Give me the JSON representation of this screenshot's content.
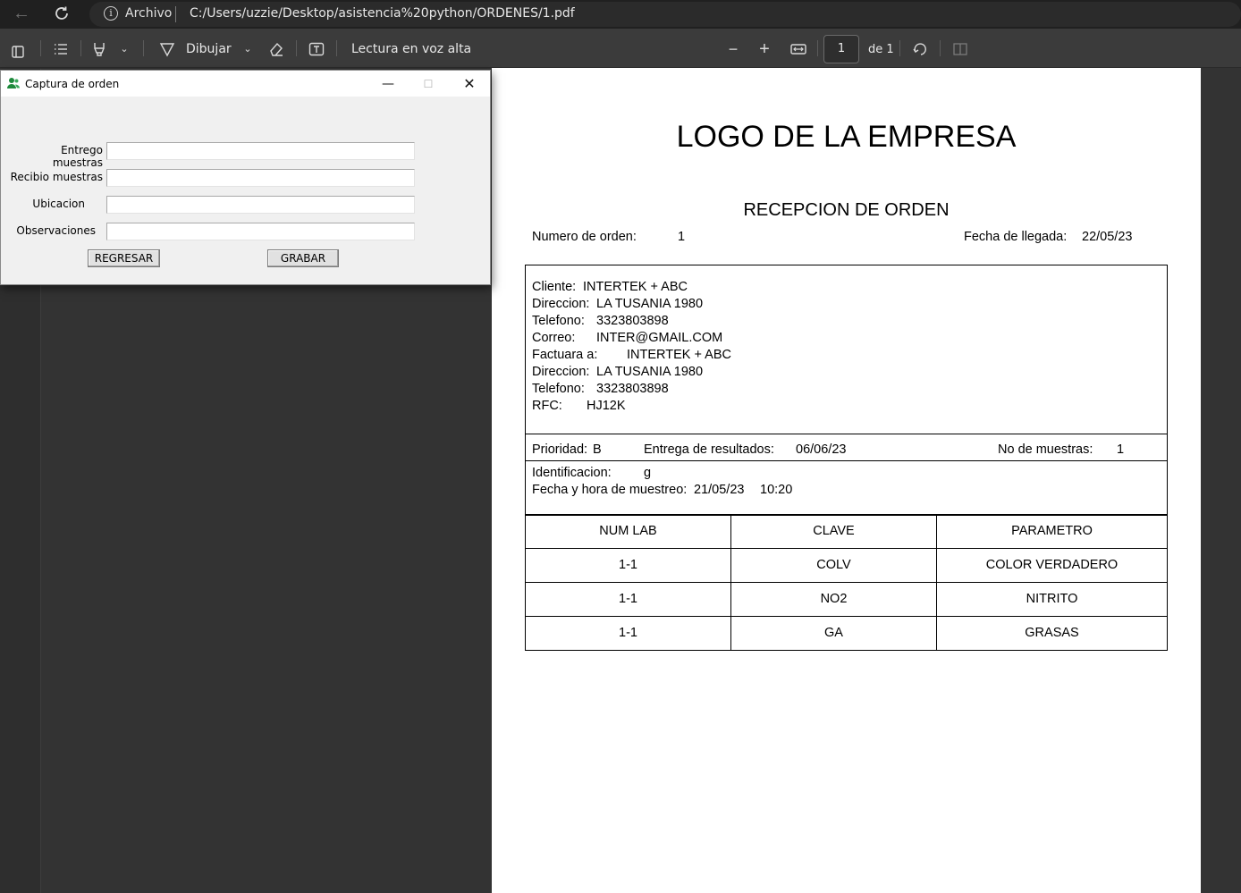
{
  "browser": {
    "file_label": "Archivo",
    "url": "C:/Users/uzzie/Desktop/asistencia%20python/ORDENES/1.pdf"
  },
  "toolbar": {
    "draw_label": "Dibujar",
    "read_aloud_label": "Lectura en voz alta",
    "page_current": "1",
    "page_total_label": "de 1",
    "icons": [
      "sidebar-icon",
      "contents-icon",
      "highlight-icon",
      "chevron-down-icon",
      "draw-icon",
      "eraser-icon",
      "text-box-icon",
      "zoom-out-icon",
      "zoom-in-icon",
      "fit-page-icon",
      "rotate-icon",
      "two-page-icon"
    ]
  },
  "dialog": {
    "title": "Captura de orden",
    "fields": [
      {
        "label": "Entrego muestras",
        "value": ""
      },
      {
        "label": "Recibio muestras",
        "value": ""
      },
      {
        "label": "Ubicacion",
        "value": ""
      },
      {
        "label": "Observaciones",
        "value": ""
      }
    ],
    "back_button": "REGRESAR",
    "save_button": "GRABAR"
  },
  "document": {
    "logo_text": "LOGO DE LA EMPRESA",
    "title": "RECEPCION DE ORDEN",
    "order_number_label": "Numero de orden:",
    "order_number": "1",
    "arrival_date_label": "Fecha de llegada:",
    "arrival_date": "22/05/23",
    "client": {
      "cliente_label": "Cliente:",
      "cliente": "INTERTEK + ABC",
      "direccion_label": "Direccion:",
      "direccion": "LA TUSANIA 1980",
      "telefono_label": "Telefono:",
      "telefono": "3323803898",
      "correo_label": "Correo:",
      "correo": "INTER@GMAIL.COM",
      "factura_label": "Factuara a:",
      "factura": "INTERTEK + ABC",
      "direccion2_label": "Direccion:",
      "direccion2": "LA TUSANIA 1980",
      "telefono2_label": "Telefono:",
      "telefono2": "3323803898",
      "rfc_label": "RFC:",
      "rfc": "HJ12K"
    },
    "priority_label": "Prioridad:",
    "priority": "B",
    "results_label": "Entrega de resultados:",
    "results_date": "06/06/23",
    "samples_label": "No de muestras:",
    "samples": "1",
    "identification_label": "Identificacion:",
    "identification": "g",
    "sampling_label": "Fecha y hora de muestreo:",
    "sampling_date": "21/05/23",
    "sampling_time": "10:20",
    "table": {
      "headers": [
        "NUM LAB",
        "CLAVE",
        "PARAMETRO"
      ],
      "rows": [
        [
          "1-1",
          "COLV",
          "COLOR VERDADERO"
        ],
        [
          "1-1",
          "NO2",
          "NITRITO"
        ],
        [
          "1-1",
          "GA",
          "GRASAS"
        ]
      ]
    }
  }
}
